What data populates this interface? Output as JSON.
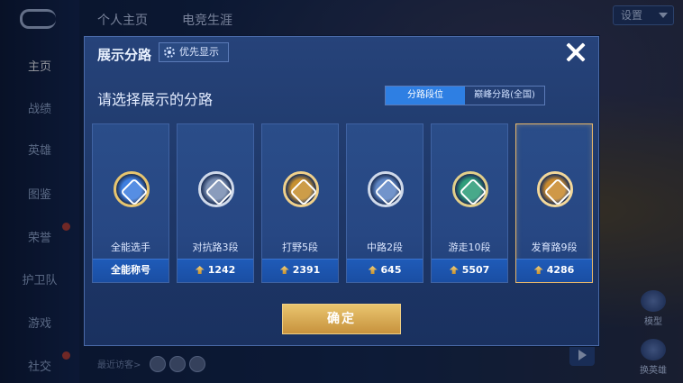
{
  "sidebar": {
    "items": [
      {
        "label": "主页",
        "active": true,
        "badge": false
      },
      {
        "label": "战绩",
        "active": false,
        "badge": false
      },
      {
        "label": "英雄",
        "active": false,
        "badge": false
      },
      {
        "label": "图鉴",
        "active": false,
        "badge": false
      },
      {
        "label": "荣誉",
        "active": false,
        "badge": true
      },
      {
        "label": "护卫队",
        "active": false,
        "badge": false
      },
      {
        "label": "游戏",
        "active": false,
        "badge": false
      },
      {
        "label": "社交",
        "active": false,
        "badge": true
      }
    ]
  },
  "top_tabs": [
    {
      "label": "个人主页"
    },
    {
      "label": "电竞生涯"
    }
  ],
  "top_right": {
    "label": "设置"
  },
  "bottom": {
    "recent_visitors": "最近访客>"
  },
  "right_side": [
    {
      "label": "模型",
      "icon": "model-icon"
    },
    {
      "label": "换英雄",
      "icon": "swap-hero-icon"
    }
  ],
  "modal": {
    "title": "展示分路",
    "priority_label": "优先显示",
    "subtitle": "请选择展示的分路",
    "segments": [
      {
        "label": "分路段位",
        "active": true
      },
      {
        "label": "巅峰分路(全国)",
        "active": false
      }
    ],
    "cards": [
      {
        "label": "全能选手",
        "value": "全能称号",
        "has_arrow": false,
        "selected": false,
        "icon": "all-rounder-emblem-icon",
        "color": "#3f7fe0",
        "ring": "#e7c56f"
      },
      {
        "label": "对抗路3段",
        "value": "1242",
        "has_arrow": true,
        "selected": false,
        "icon": "clash-lane-emblem-icon",
        "color": "#7a8fb3",
        "ring": "#cfd9ea"
      },
      {
        "label": "打野5段",
        "value": "2391",
        "has_arrow": true,
        "selected": false,
        "icon": "jungle-emblem-icon",
        "color": "#c7902f",
        "ring": "#f0d08a"
      },
      {
        "label": "中路2段",
        "value": "645",
        "has_arrow": true,
        "selected": false,
        "icon": "mid-lane-emblem-icon",
        "color": "#5f86c4",
        "ring": "#cfd9ea"
      },
      {
        "label": "游走10段",
        "value": "5507",
        "has_arrow": true,
        "selected": false,
        "icon": "roam-emblem-icon",
        "color": "#2f9e7a",
        "ring": "#e2cf8a"
      },
      {
        "label": "发育路9段",
        "value": "4286",
        "has_arrow": true,
        "selected": true,
        "icon": "farm-lane-emblem-icon",
        "color": "#c98a2f",
        "ring": "#f2d79a"
      }
    ],
    "confirm_label": "确定"
  }
}
